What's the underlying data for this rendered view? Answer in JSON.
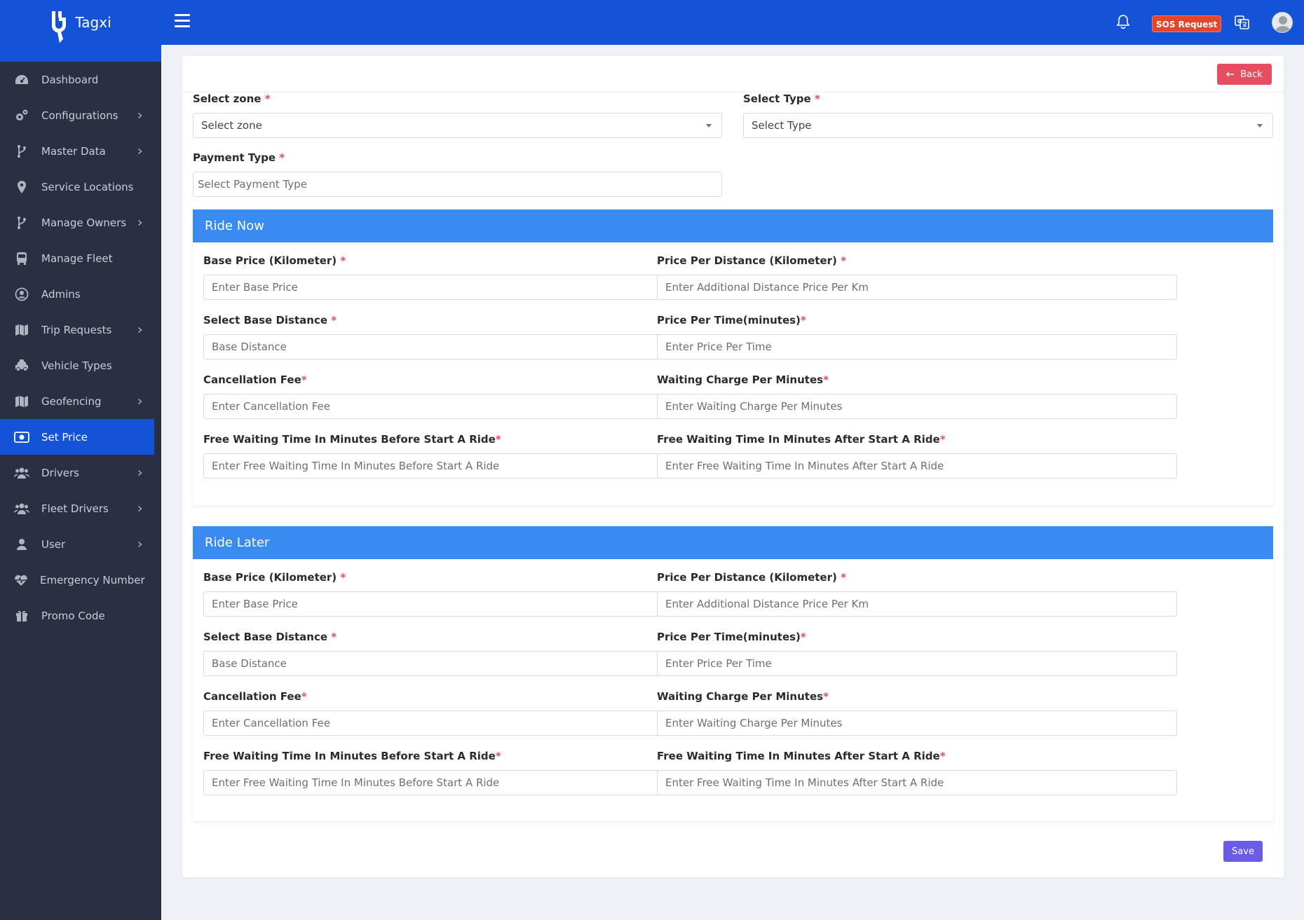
{
  "brand": {
    "name": "Tagxi"
  },
  "sidebar": {
    "items": [
      {
        "label": "Dashboard",
        "icon": "dashboard-icon",
        "chevron": false,
        "active": false
      },
      {
        "label": "Configurations",
        "icon": "cogs-icon",
        "chevron": true,
        "active": false
      },
      {
        "label": "Master Data",
        "icon": "branch-icon",
        "chevron": true,
        "active": false
      },
      {
        "label": "Service Locations",
        "icon": "map-pin-icon",
        "chevron": false,
        "active": false
      },
      {
        "label": "Manage Owners",
        "icon": "branch-icon",
        "chevron": true,
        "active": false
      },
      {
        "label": "Manage Fleet",
        "icon": "bus-icon",
        "chevron": false,
        "active": false
      },
      {
        "label": "Admins",
        "icon": "user-circle-icon",
        "chevron": false,
        "active": false
      },
      {
        "label": "Trip Requests",
        "icon": "map-icon",
        "chevron": true,
        "active": false
      },
      {
        "label": "Vehicle Types",
        "icon": "taxi-icon",
        "chevron": false,
        "active": false
      },
      {
        "label": "Geofencing",
        "icon": "map-icon",
        "chevron": true,
        "active": false
      },
      {
        "label": "Set Price",
        "icon": "money-icon",
        "chevron": false,
        "active": true
      },
      {
        "label": "Drivers",
        "icon": "users-icon",
        "chevron": true,
        "active": false
      },
      {
        "label": "Fleet Drivers",
        "icon": "users-icon",
        "chevron": true,
        "active": false
      },
      {
        "label": "User",
        "icon": "user-icon",
        "chevron": true,
        "active": false
      },
      {
        "label": "Emergency Number",
        "icon": "heartbeat-icon",
        "chevron": false,
        "active": false
      },
      {
        "label": "Promo Code",
        "icon": "gift-icon",
        "chevron": false,
        "active": false
      }
    ]
  },
  "header": {
    "sos_label": "SOS Request"
  },
  "toolbar": {
    "back_label": "Back",
    "save_label": "Save"
  },
  "top_fields": {
    "zone": {
      "label": "Select zone",
      "value": "Select zone"
    },
    "type": {
      "label": "Select Type",
      "value": "Select Type"
    },
    "payment": {
      "label": "Payment Type",
      "placeholder": "Select Payment Type"
    }
  },
  "ride_now": {
    "title": "Ride Now",
    "fields": {
      "base_price": {
        "label": "Base Price  (Kilometer) ",
        "placeholder": "Enter Base Price"
      },
      "price_per_distance": {
        "label": "Price Per Distance  (Kilometer) ",
        "placeholder": "Enter Additional Distance Price Per Km"
      },
      "base_distance": {
        "label": "Select Base Distance ",
        "placeholder": "Base Distance"
      },
      "price_per_time": {
        "label": "Price Per Time(minutes)",
        "placeholder": "Enter Price Per Time"
      },
      "cancellation_fee": {
        "label": "Cancellation Fee",
        "placeholder": "Enter Cancellation Fee"
      },
      "waiting_charge": {
        "label": "Waiting Charge Per Minutes",
        "placeholder": "Enter Waiting Charge Per Minutes"
      },
      "free_wait_before": {
        "label": "Free Waiting Time In Minutes Before Start A Ride",
        "placeholder": "Enter Free Waiting Time In Minutes Before Start A Ride"
      },
      "free_wait_after": {
        "label": "Free Waiting Time In Minutes After Start A Ride",
        "placeholder": "Enter Free Waiting Time In Minutes After Start A Ride"
      }
    }
  },
  "ride_later": {
    "title": "Ride Later",
    "fields": {
      "base_price": {
        "label": "Base Price  (Kilometer) ",
        "placeholder": "Enter Base Price"
      },
      "price_per_distance": {
        "label": "Price Per Distance  (Kilometer) ",
        "placeholder": "Enter Additional Distance Price Per Km"
      },
      "base_distance": {
        "label": "Select Base Distance ",
        "placeholder": "Base Distance"
      },
      "price_per_time": {
        "label": "Price Per Time(minutes)",
        "placeholder": "Enter Price Per Time"
      },
      "cancellation_fee": {
        "label": "Cancellation Fee",
        "placeholder": "Enter Cancellation Fee"
      },
      "waiting_charge": {
        "label": "Waiting Charge Per Minutes",
        "placeholder": "Enter Waiting Charge Per Minutes"
      },
      "free_wait_before": {
        "label": "Free Waiting Time In Minutes Before Start A Ride",
        "placeholder": "Enter Free Waiting Time In Minutes Before Start A Ride"
      },
      "free_wait_after": {
        "label": "Free Waiting Time In Minutes After Start A Ride",
        "placeholder": "Enter Free Waiting Time In Minutes After Start A Ride"
      }
    }
  },
  "colors": {
    "primary": "#1553d6",
    "sidebar_bg": "#293043",
    "section_header": "#3a8bef",
    "back_button": "#e54d61",
    "save_button": "#6a5ce8",
    "sos_badge": "#e5452b",
    "required_mark": "#e54d61"
  }
}
